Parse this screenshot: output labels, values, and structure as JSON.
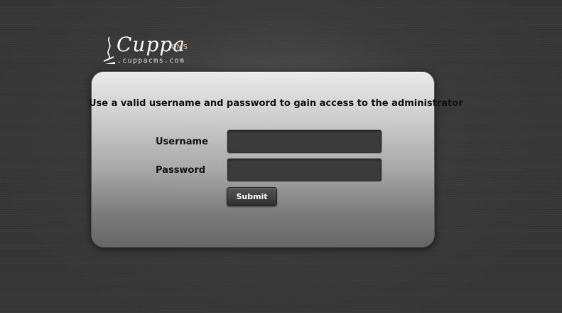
{
  "logo": {
    "name": "Cuppa",
    "suffix": "CMS",
    "url": ".cuppacms.com",
    "icon": "coffee-steam-icon"
  },
  "login": {
    "message": "Use a valid username and password to gain access to the administrator",
    "username_label": "Username",
    "username_value": "",
    "password_label": "Password",
    "password_value": "",
    "submit_label": "Submit"
  },
  "colors": {
    "background": "#353535",
    "panel_top": "#e9e9e9",
    "panel_bottom": "#666666",
    "input_bg": "#3b3b3b",
    "button_bg": "#3a3a3a",
    "logo_accent": "#e6c88a"
  }
}
